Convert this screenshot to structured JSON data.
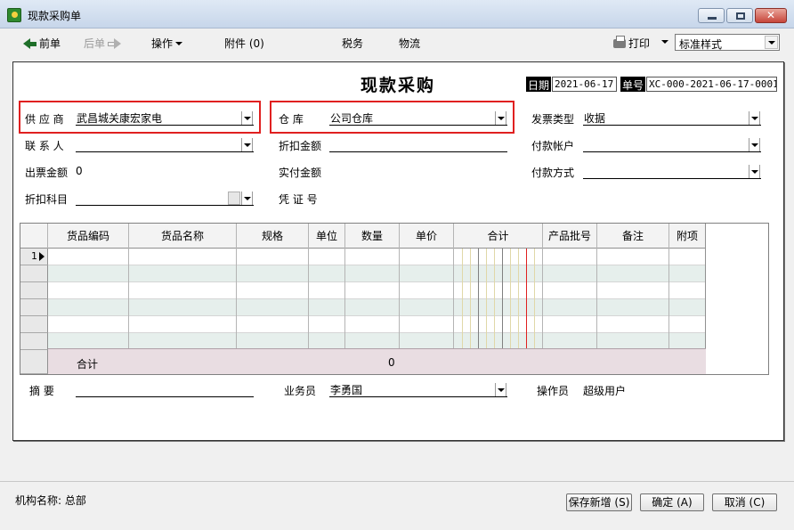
{
  "window": {
    "title": "现款采购单"
  },
  "toolbar": {
    "prev_label": "前单",
    "next_label": "后单",
    "operation_label": "操作",
    "attachment_label": "附件 (0)",
    "tax_label": "税务",
    "logistics_label": "物流",
    "print_label": "打印",
    "style_value": "标准样式"
  },
  "form": {
    "title": "现款采购",
    "date_label": "日期",
    "date_value": "2021-06-17",
    "number_label": "单号",
    "number_value": "XC-000-2021-06-17-0001",
    "supplier_label": "供 应 商",
    "supplier_value": "武昌城关康宏家电",
    "warehouse_label": "仓    库",
    "warehouse_value": "公司仓库",
    "invoice_type_label": "发票类型",
    "invoice_type_value": "收据",
    "contact_label": "联 系 人",
    "contact_value": "",
    "discount_amount_label": "折扣金额",
    "discount_amount_value": "",
    "payment_account_label": "付款帐户",
    "payment_account_value": "",
    "invoice_amount_label": "出票金额",
    "invoice_amount_value": "0",
    "actual_paid_label": "实付金额",
    "actual_paid_value": "",
    "payment_method_label": "付款方式",
    "payment_method_value": "",
    "discount_subject_label": "折扣科目",
    "discount_subject_value": "",
    "voucher_label": "凭 证 号",
    "voucher_value": ""
  },
  "grid": {
    "columns": [
      "货品编码",
      "货品名称",
      "规格",
      "单位",
      "数量",
      "单价",
      "合计",
      "产品批号",
      "备注",
      "附项"
    ],
    "row_numbers": [
      "1"
    ],
    "total_label": "合计",
    "total_quantity": "0"
  },
  "footer": {
    "summary_label": "摘    要",
    "summary_value": "",
    "salesperson_label": "业务员",
    "salesperson_value": "李勇国",
    "operator_label": "操作员",
    "operator_value": "超级用户"
  },
  "bottom": {
    "org_label": "机构名称: 总部",
    "save_new_label": "保存新增 (S)",
    "confirm_label": "确定 (A)",
    "cancel_label": "取消 (C)"
  },
  "colors": {
    "highlight_box": "#e02020"
  }
}
